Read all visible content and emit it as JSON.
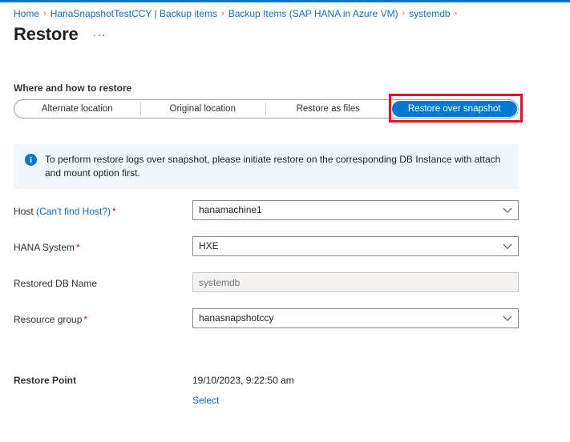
{
  "theme": {
    "accent": "#0078d4",
    "link": "#0f6cbd",
    "required_asterisk": "#a4262c",
    "info_banner_bg": "#eff6fc",
    "highlight_outline": "#e81123"
  },
  "breadcrumb": {
    "separator": "›",
    "items": [
      {
        "label": "Home"
      },
      {
        "label": "HanaSnapshotTestCCY | Backup items"
      },
      {
        "label": "Backup Items (SAP HANA in Azure VM)"
      },
      {
        "label": "systemdb"
      }
    ]
  },
  "header": {
    "title": "Restore",
    "more_commands": "···"
  },
  "restore_options": {
    "section_heading": "Where and how to restore",
    "tabs": [
      {
        "label": "Alternate location",
        "selected": false
      },
      {
        "label": "Original location",
        "selected": false
      },
      {
        "label": "Restore as files",
        "selected": false
      },
      {
        "label": "Restore over snapshot",
        "selected": true
      }
    ]
  },
  "info_banner": {
    "icon": "info-icon",
    "icon_glyph": "i",
    "text": "To perform restore logs over snapshot, please initiate restore on the corresponding DB Instance with attach and mount option first."
  },
  "form": {
    "host": {
      "label_prefix": "Host ",
      "label_link": "(Can't find Host?)",
      "required": "*",
      "value": "hanamachine1",
      "placeholder": ""
    },
    "hana_system": {
      "label": "HANA System",
      "required": "*",
      "value": "HXE",
      "placeholder": ""
    },
    "restored_db_name": {
      "label": "Restored DB Name",
      "value": "",
      "placeholder": "systemdb"
    },
    "resource_group": {
      "label": "Resource group",
      "required": "*",
      "value": "hanasnapshotccy",
      "placeholder": ""
    }
  },
  "restore_point": {
    "label": "Restore Point",
    "value": "19/10/2023, 9:22:50 am",
    "select_link": "Select"
  }
}
